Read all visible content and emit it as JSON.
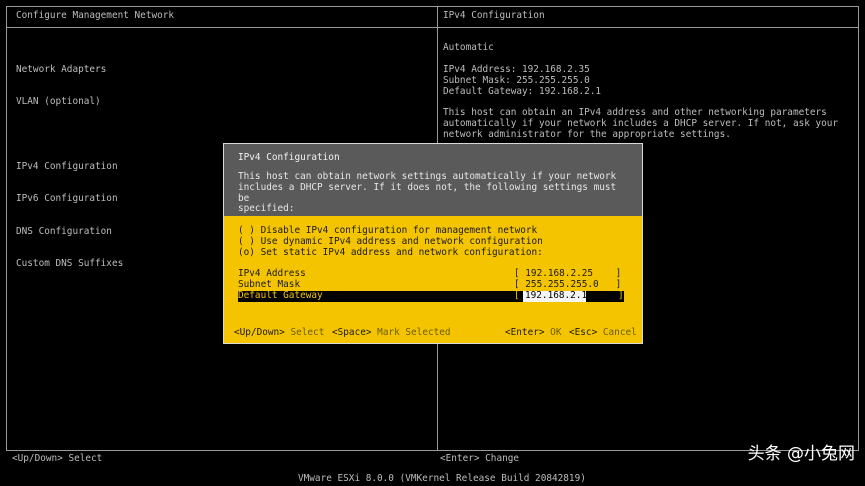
{
  "left": {
    "title": "Configure Management Network",
    "menu": [
      "Network Adapters",
      "VLAN (optional)",
      "",
      "IPv4 Configuration",
      "IPv6 Configuration",
      "DNS Configuration",
      "Custom DNS Suffixes"
    ]
  },
  "right": {
    "title": "IPv4 Configuration",
    "mode": "Automatic",
    "ipv4_address": "IPv4 Address: 192.168.2.35",
    "subnet_mask": "Subnet Mask: 255.255.255.0",
    "default_gateway": "Default Gateway: 192.168.2.1",
    "desc_lines": [
      "This host can obtain an IPv4 address and other networking parameters",
      "automatically if your network includes a DHCP server. If not, ask your",
      "network administrator for the appropriate settings."
    ]
  },
  "dialog": {
    "title": "IPv4 Configuration",
    "desc": "This host can obtain network settings automatically if your network\nincludes a DHCP server. If it does not, the following settings must be\nspecified:",
    "options": [
      "( ) Disable IPv4 configuration for management network",
      "( ) Use dynamic IPv4 address and network configuration",
      "(o) Set static IPv4 address and network configuration:"
    ],
    "fields": {
      "ipv4_label": "IPv4 Address",
      "ipv4_value": "[ 192.168.2.25    ]",
      "mask_label": "Subnet Mask",
      "mask_value": "[ 255.255.255.0   ]",
      "gw_label": "Default Gateway",
      "gw_open": "[",
      "gw_value": "192.168.2.1",
      "gw_close": "]"
    },
    "hints": {
      "updown_key": "<Up/Down>",
      "updown_text": "Select",
      "space_key": "<Space>",
      "space_text": "Mark Selected",
      "enter_key": "<Enter>",
      "enter_text": "OK",
      "esc_key": "<Esc>",
      "esc_text": "Cancel"
    }
  },
  "footer": {
    "updown": "<Up/Down> Select",
    "enter": "<Enter> Change",
    "version": "VMware ESXi 8.0.0 (VMKernel Release Build 20842819)"
  },
  "watermark": "头条 @小兔网"
}
